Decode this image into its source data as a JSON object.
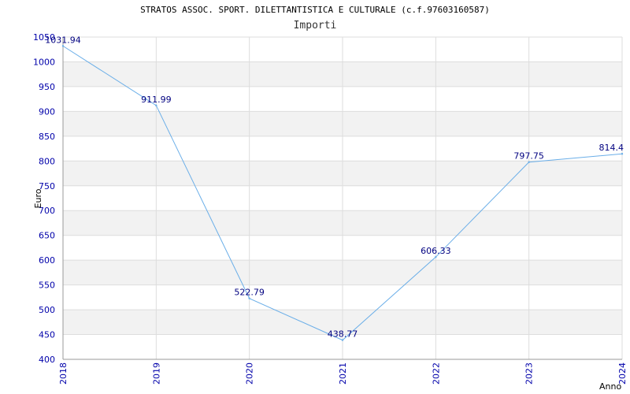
{
  "chart_data": {
    "type": "line",
    "title": "STRATOS ASSOC. SPORT. DILETTANTISTICA E CULTURALE (c.f.97603160587)",
    "subtitle": "Importi",
    "xlabel": "Anno",
    "ylabel": "Euro",
    "x": [
      "2018",
      "2019",
      "2020",
      "2021",
      "2022",
      "2023",
      "2024"
    ],
    "series": [
      {
        "values": [
          1031.94,
          911.99,
          522.79,
          438.77,
          606.33,
          797.75,
          814.4
        ],
        "labels": [
          "1031.94",
          "911.99",
          "522.79",
          "438.77",
          "606.33",
          "797.75",
          "814.4"
        ]
      }
    ],
    "ylim": [
      400,
      1050
    ],
    "yticks": [
      400,
      450,
      500,
      550,
      600,
      650,
      700,
      750,
      800,
      850,
      900,
      950,
      1000,
      1050
    ],
    "grid": true,
    "colors": {
      "line": "#6aaee8",
      "axis_text": "#0000aa",
      "label_text": "#000080",
      "band": "#f2f2f2",
      "grid": "#dddddd"
    }
  }
}
